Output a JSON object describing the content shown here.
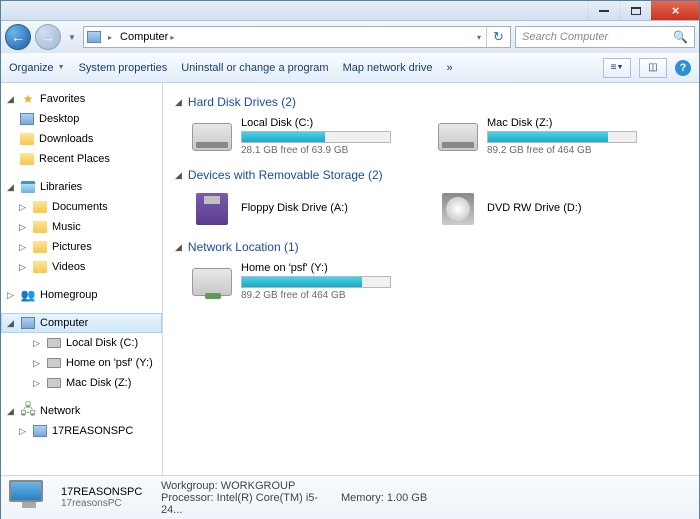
{
  "nav": {
    "crumb": "Computer"
  },
  "search": {
    "placeholder": "Search Computer"
  },
  "toolbar": {
    "organize": "Organize",
    "sysprops": "System properties",
    "uninstall": "Uninstall or change a program",
    "mapdrive": "Map network drive",
    "more": "»"
  },
  "sidebar": {
    "fav": "Favorites",
    "fav_items": [
      "Desktop",
      "Downloads",
      "Recent Places"
    ],
    "lib": "Libraries",
    "lib_items": [
      "Documents",
      "Music",
      "Pictures",
      "Videos"
    ],
    "hg": "Homegroup",
    "comp": "Computer",
    "comp_items": [
      "Local Disk (C:)",
      "Home on 'psf' (Y:)",
      "Mac Disk (Z:)"
    ],
    "net": "Network",
    "net_items": [
      "17REASONSPC"
    ]
  },
  "sections": {
    "hdd": "Hard Disk Drives (2)",
    "removable": "Devices with Removable Storage (2)",
    "netloc": "Network Location (1)"
  },
  "drives": {
    "c": {
      "name": "Local Disk (C:)",
      "free": "28.1 GB free of 63.9 GB",
      "pct": 56
    },
    "z": {
      "name": "Mac Disk (Z:)",
      "free": "89.2 GB free of 464 GB",
      "pct": 81
    },
    "a": {
      "name": "Floppy Disk Drive (A:)"
    },
    "d": {
      "name": "DVD RW Drive (D:)"
    },
    "y": {
      "name": "Home on 'psf' (Y:)",
      "free": "89.2 GB free of 464 GB",
      "pct": 81
    }
  },
  "details": {
    "name": "17REASONSPC",
    "domain": "17reasonsPC",
    "wg_label": "Workgroup:",
    "wg": "WORKGROUP",
    "proc_label": "Processor:",
    "proc": "Intel(R) Core(TM) i5-24...",
    "mem_label": "Memory:",
    "mem": "1.00 GB"
  }
}
